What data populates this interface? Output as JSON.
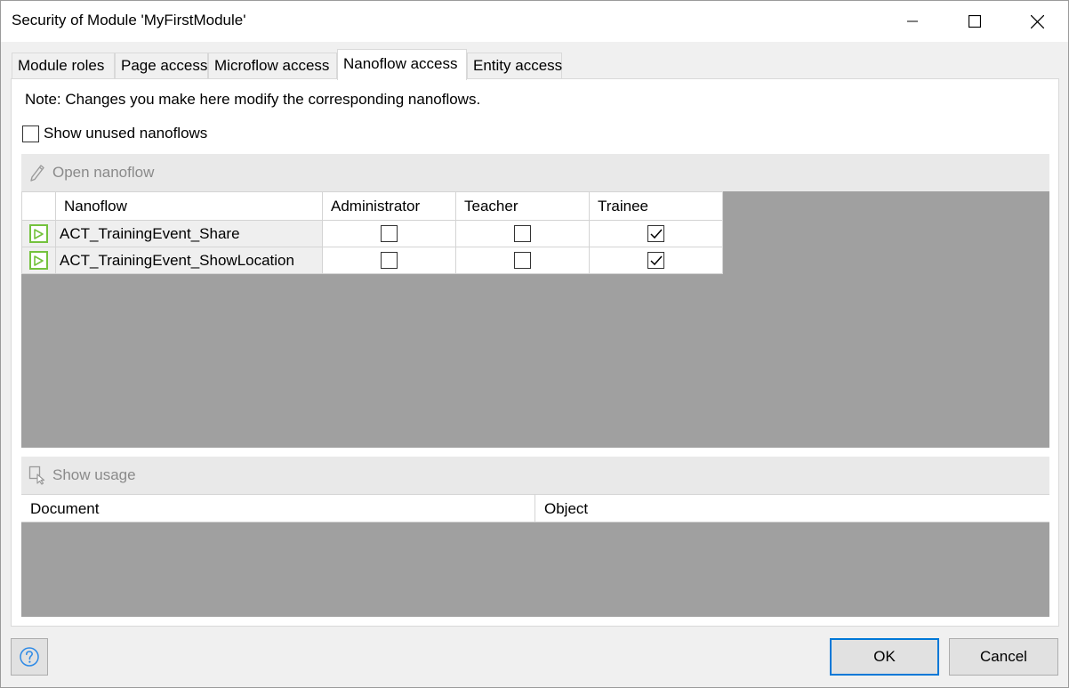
{
  "window": {
    "title": "Security of Module 'MyFirstModule'"
  },
  "tabs": [
    {
      "label": "Module roles",
      "active": false
    },
    {
      "label": "Page access",
      "active": false
    },
    {
      "label": "Microflow access",
      "active": false
    },
    {
      "label": "Nanoflow access",
      "active": true
    },
    {
      "label": "Entity access",
      "active": false
    }
  ],
  "panel": {
    "note": "Note: Changes you make here modify the corresponding nanoflows.",
    "show_unused_label": "Show unused nanoflows",
    "show_unused_checked": false,
    "open_nanoflow_label": "Open nanoflow",
    "show_usage_label": "Show usage"
  },
  "grid": {
    "columns": [
      "Nanoflow",
      "Administrator",
      "Teacher",
      "Trainee"
    ],
    "rows": [
      {
        "name": "ACT_TrainingEvent_Share",
        "administrator": false,
        "teacher": false,
        "trainee": true
      },
      {
        "name": "ACT_TrainingEvent_ShowLocation",
        "administrator": false,
        "teacher": false,
        "trainee": true
      }
    ]
  },
  "usage": {
    "columns": [
      "Document",
      "Object"
    ]
  },
  "buttons": {
    "ok": "OK",
    "cancel": "Cancel"
  },
  "colors": {
    "accent": "#0078d7",
    "nanoflow_icon": "#74c23d",
    "empty_area": "#a0a0a0"
  }
}
